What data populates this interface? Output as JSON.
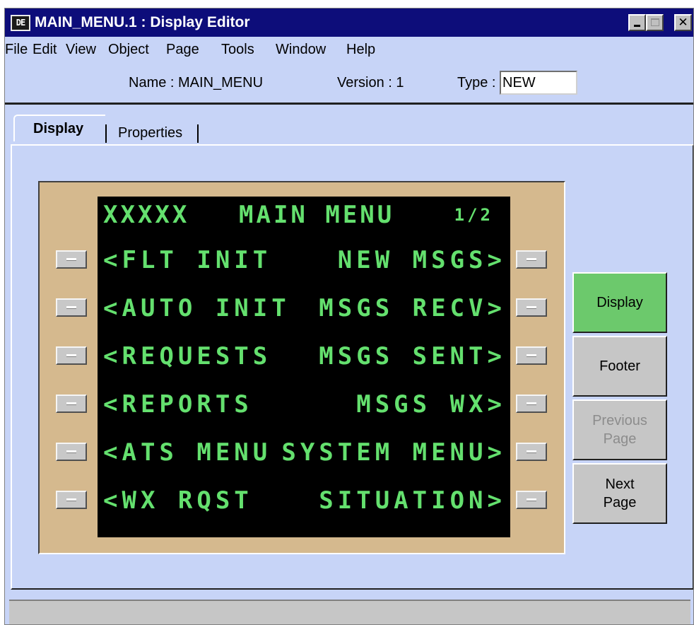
{
  "window": {
    "title": "MAIN_MENU.1 : Display Editor",
    "icon_label": "DE"
  },
  "menubar": {
    "items": [
      "File",
      "Edit",
      "View",
      "Object",
      "Page",
      "Tools",
      "Window",
      "Help"
    ]
  },
  "info": {
    "name": "Name : MAIN_MENU",
    "version": "Version : 1",
    "type_label": "Type :",
    "type_value": "NEW"
  },
  "tabs": {
    "display": "Display",
    "properties": "Properties"
  },
  "cdu": {
    "title_left": "XXXXX",
    "title_center": "MAIN MENU",
    "page": "1/2",
    "left_lines": [
      "<FLT INIT",
      "<AUTO INIT",
      "<REQUESTS",
      "<REPORTS",
      "<ATS MENU",
      "<WX RQST"
    ],
    "right_lines": [
      "NEW MSGS>",
      "MSGS RECV>",
      "MSGS SENT>",
      "MSGS WX>",
      "SYSTEM MENU>",
      "SITUATION>"
    ],
    "text_color": "#64e06e",
    "screen_color": "#000000",
    "bezel_color": "#d5b98e"
  },
  "side_buttons": {
    "display": "Display",
    "footer": "Footer",
    "previous_page_1": "Previous",
    "previous_page_2": "Page",
    "next_page_1": "Next",
    "next_page_2": "Page",
    "active_color": "#6cc96c"
  }
}
